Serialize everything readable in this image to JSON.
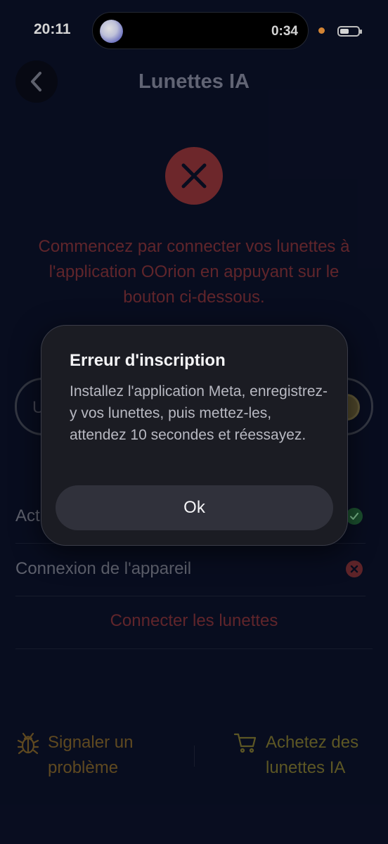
{
  "status_bar": {
    "time": "20:11",
    "island_timer": "0:34"
  },
  "header": {
    "title": "Lunettes IA"
  },
  "instruction": "Commencez par connecter vos lunettes à l'application OOrion en appuyant sur le bouton ci-dessous.",
  "background_pill": {
    "letter": "U"
  },
  "rows": [
    {
      "label": "Act",
      "status": "ok"
    },
    {
      "label": "Connexion de l'appareil",
      "status": "error"
    }
  ],
  "connect_link": "Connecter les lunettes",
  "footer": {
    "report": {
      "line1": "Signaler un",
      "line2": "problème"
    },
    "buy": {
      "line1": "Achetez des",
      "line2": "lunettes IA"
    }
  },
  "alert": {
    "title": "Erreur d'inscription",
    "message": "Installez l'application Meta, enregistrez-y vos lunettes, puis mettez-les, attendez 10 secondes et réessayez.",
    "ok_label": "Ok"
  },
  "colors": {
    "error_red": "#7d2d32",
    "success_green": "#1f5b35",
    "report_orange": "#6d5425",
    "buy_yellow": "#6a632a"
  },
  "icons": [
    "back-chevron-icon",
    "error-x-icon",
    "check-icon",
    "cross-icon",
    "bug-icon",
    "cart-icon",
    "battery-icon"
  ]
}
